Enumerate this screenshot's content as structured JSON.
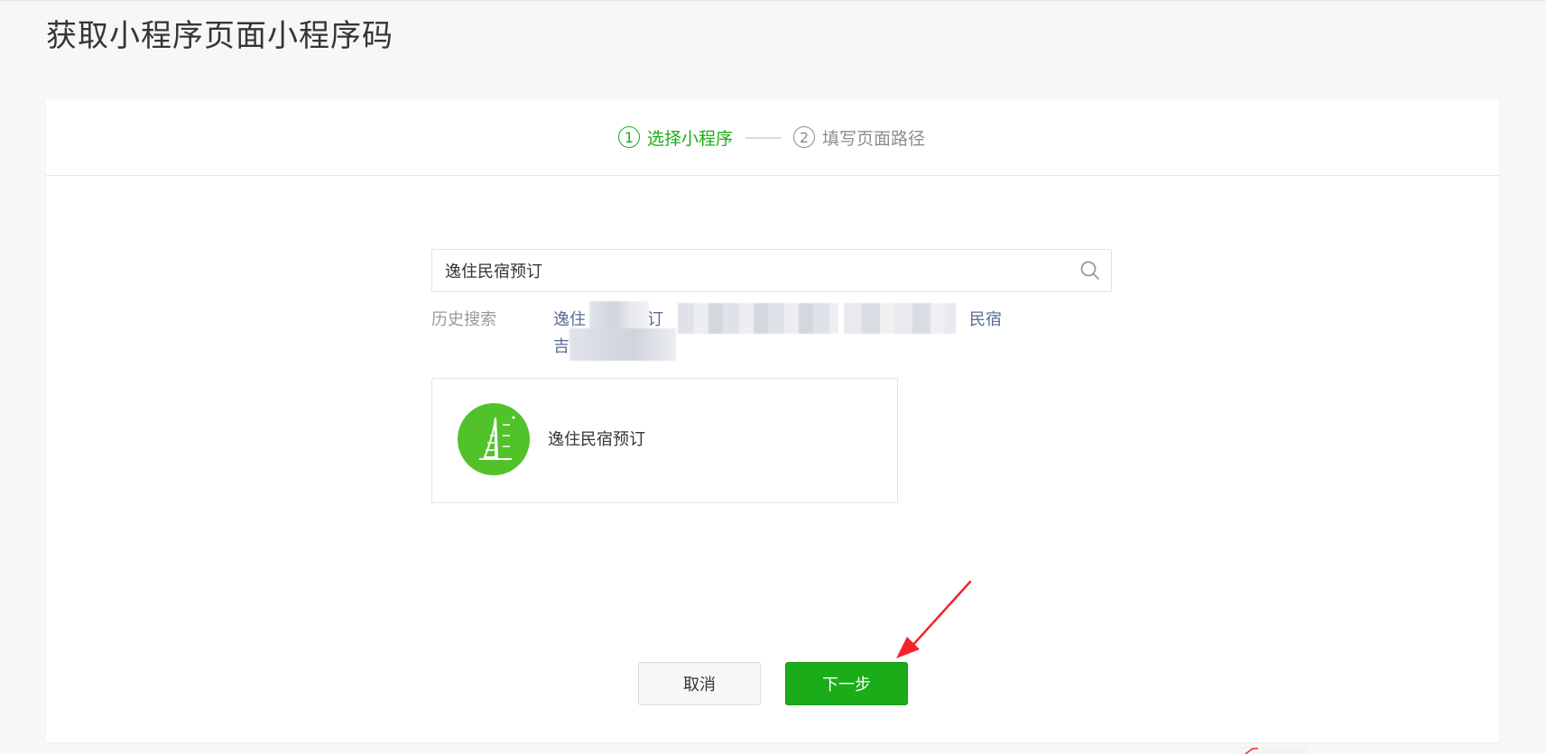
{
  "page": {
    "title": "获取小程序页面小程序码"
  },
  "steps": [
    {
      "number": "1",
      "label": "选择小程序",
      "state": "active"
    },
    {
      "number": "2",
      "label": "填写页面路径",
      "state": "inactive"
    }
  ],
  "search": {
    "value": "逸住民宿预订",
    "icon": "search-icon"
  },
  "history": {
    "label": "历史搜索",
    "visible_fragments": [
      "逸住",
      "订",
      "民宿",
      "吉"
    ]
  },
  "results": [
    {
      "name": "逸住民宿预订",
      "avatar_icon": "app-logo-icon"
    }
  ],
  "buttons": {
    "cancel": "取消",
    "next": "下一步"
  },
  "colors": {
    "accent": "#1aad19",
    "link": "#576b95",
    "avatar_bg": "#52c22a",
    "annotation_arrow": "#f5222d"
  }
}
